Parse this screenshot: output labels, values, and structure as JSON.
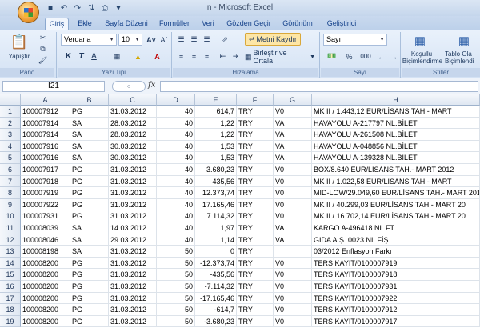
{
  "window_title": "n - Microsoft Excel",
  "tabs": [
    "Giriş",
    "Ekle",
    "Sayfa Düzeni",
    "Formüller",
    "Veri",
    "Gözden Geçir",
    "Görünüm",
    "Geliştirici"
  ],
  "ribbon": {
    "paste_label": "Yapıştır",
    "font_name": "Verdana",
    "font_size": "10",
    "wrap_text": "Metni Kaydır",
    "merge_center": "Birleştir ve Ortala",
    "number_format": "Sayı",
    "percent": "%",
    "thousands": "000",
    "conditional_formatting_line1": "Koşullu",
    "conditional_formatting_line2": "Biçimlendirme",
    "table_format_line1": "Tablo Ola",
    "table_format_line2": "Biçimlendi",
    "groups": {
      "clipboard": "Pano",
      "font": "Yazı Tipi",
      "alignment": "Hizalama",
      "number": "Sayı",
      "styles": "Stiller"
    }
  },
  "formula_bar": {
    "name_box": "I21",
    "fx": "fx",
    "value": ""
  },
  "columns": [
    "A",
    "B",
    "C",
    "D",
    "E",
    "F",
    "G",
    "H"
  ],
  "rows": [
    {
      "n": "1",
      "a": "100007912",
      "b": "PG",
      "c": "31.03.2012",
      "d": "40",
      "e": "614,7",
      "f": "TRY",
      "g": "V0",
      "h": "MK II  / 1.443,12 EUR/LİSANS TAH.- MART"
    },
    {
      "n": "2",
      "a": "100007914",
      "b": "SA",
      "c": "28.03.2012",
      "d": "40",
      "e": "1,22",
      "f": "TRY",
      "g": "VA",
      "h": "HAVAYOLU  A-217797 NL.BİLET"
    },
    {
      "n": "3",
      "a": "100007914",
      "b": "SA",
      "c": "28.03.2012",
      "d": "40",
      "e": "1,22",
      "f": "TRY",
      "g": "VA",
      "h": "HAVAYOLU  A-261508 NL.BİLET"
    },
    {
      "n": "4",
      "a": "100007916",
      "b": "SA",
      "c": "30.03.2012",
      "d": "40",
      "e": "1,53",
      "f": "TRY",
      "g": "VA",
      "h": "HAVAYOLU  A-048856 NL.BİLET"
    },
    {
      "n": "5",
      "a": "100007916",
      "b": "SA",
      "c": "30.03.2012",
      "d": "40",
      "e": "1,53",
      "f": "TRY",
      "g": "VA",
      "h": "HAVAYOLU  A-139328 NL.BİLET"
    },
    {
      "n": "6",
      "a": "100007917",
      "b": "PG",
      "c": "31.03.2012",
      "d": "40",
      "e": "3.680,23",
      "f": "TRY",
      "g": "V0",
      "h": "BOX/8.640 EUR/LİSANS TAH.- MART 2012"
    },
    {
      "n": "7",
      "a": "100007918",
      "b": "PG",
      "c": "31.03.2012",
      "d": "40",
      "e": "435,56",
      "f": "TRY",
      "g": "V0",
      "h": "MK II  / 1.022,58 EUR/LİSANS TAH.- MART"
    },
    {
      "n": "8",
      "a": "100007919",
      "b": "PG",
      "c": "31.03.2012",
      "d": "40",
      "e": "12.373,74",
      "f": "TRY",
      "g": "V0",
      "h": "MID-LOW/29.049,60 EUR/LİSANS TAH.- MART 2012"
    },
    {
      "n": "9",
      "a": "100007922",
      "b": "PG",
      "c": "31.03.2012",
      "d": "40",
      "e": "17.165,46",
      "f": "TRY",
      "g": "V0",
      "h": "MK II / 40.299,03 EUR/LİSANS TAH.- MART 20"
    },
    {
      "n": "10",
      "a": "100007931",
      "b": "PG",
      "c": "31.03.2012",
      "d": "40",
      "e": "7.114,32",
      "f": "TRY",
      "g": "V0",
      "h": "MK II  / 16.702,14 EUR/LİSANS TAH.- MART 20"
    },
    {
      "n": "11",
      "a": "100008039",
      "b": "SA",
      "c": "14.03.2012",
      "d": "40",
      "e": "1,97",
      "f": "TRY",
      "g": "VA",
      "h": "KARGO A-496418 NL.FT."
    },
    {
      "n": "12",
      "a": "100008046",
      "b": "SA",
      "c": "29.03.2012",
      "d": "40",
      "e": "1,14",
      "f": "TRY",
      "g": "VA",
      "h": "GIDA A.Ş. 0023 NL.FİŞ."
    },
    {
      "n": "13",
      "a": "100008198",
      "b": "SA",
      "c": "31.03.2012",
      "d": "50",
      "e": "0",
      "f": "TRY",
      "g": "",
      "h": "03/2012 Enflasyon Farkı"
    },
    {
      "n": "14",
      "a": "100008200",
      "b": "PG",
      "c": "31.03.2012",
      "d": "50",
      "e": "-12.373,74",
      "f": "TRY",
      "g": "V0",
      "h": "TERS KAYIT/0100007919"
    },
    {
      "n": "15",
      "a": "100008200",
      "b": "PG",
      "c": "31.03.2012",
      "d": "50",
      "e": "-435,56",
      "f": "TRY",
      "g": "V0",
      "h": "TERS KAYIT/0100007918"
    },
    {
      "n": "16",
      "a": "100008200",
      "b": "PG",
      "c": "31.03.2012",
      "d": "50",
      "e": "-7.114,32",
      "f": "TRY",
      "g": "V0",
      "h": "TERS KAYIT/0100007931"
    },
    {
      "n": "17",
      "a": "100008200",
      "b": "PG",
      "c": "31.03.2012",
      "d": "50",
      "e": "-17.165,46",
      "f": "TRY",
      "g": "V0",
      "h": "TERS KAYIT/0100007922"
    },
    {
      "n": "18",
      "a": "100008200",
      "b": "PG",
      "c": "31.03.2012",
      "d": "50",
      "e": "-614,7",
      "f": "TRY",
      "g": "V0",
      "h": "TERS KAYIT/0100007912"
    },
    {
      "n": "19",
      "a": "100008200",
      "b": "PG",
      "c": "31.03.2012",
      "d": "50",
      "e": "-3.680,23",
      "f": "TRY",
      "g": "V0",
      "h": "TERS KAYIT/0100007917"
    }
  ]
}
